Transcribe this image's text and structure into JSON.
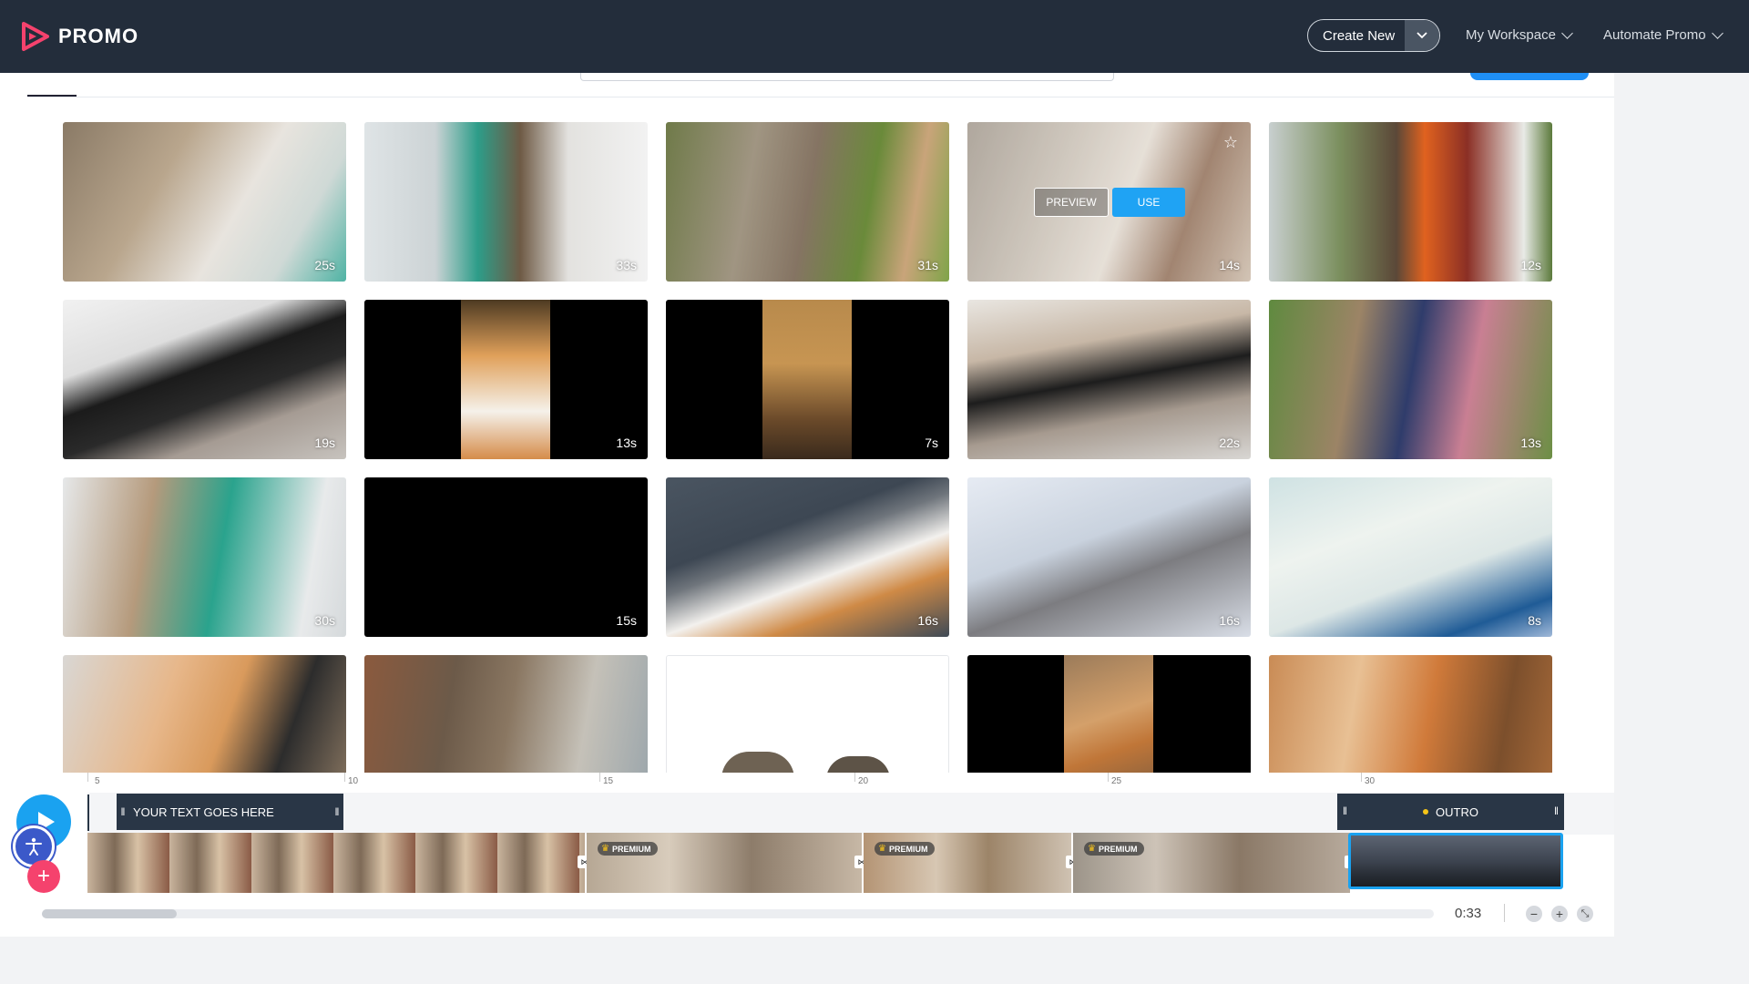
{
  "brand": {
    "name": "PROMO",
    "colors": {
      "topbar": "#232d3b",
      "accent": "#1aa2f0",
      "pink": "#f5426d"
    }
  },
  "header": {
    "create_new": "Create New",
    "my_workspace": "My Workspace",
    "automate_promo": "Automate Promo"
  },
  "grid": {
    "tiles": [
      {
        "duration": "25s"
      },
      {
        "duration": "33s"
      },
      {
        "duration": "31s"
      },
      {
        "duration": "14s",
        "hovered": true
      },
      {
        "duration": "12s"
      },
      {
        "duration": "19s"
      },
      {
        "duration": "13s"
      },
      {
        "duration": "7s"
      },
      {
        "duration": "22s"
      },
      {
        "duration": "13s"
      },
      {
        "duration": "30s"
      },
      {
        "duration": "15s"
      },
      {
        "duration": "16s"
      },
      {
        "duration": "16s"
      },
      {
        "duration": "8s"
      },
      {
        "duration": ""
      },
      {
        "duration": ""
      },
      {
        "duration": ""
      },
      {
        "duration": ""
      },
      {
        "duration": ""
      }
    ],
    "hover": {
      "preview_label": "PREVIEW",
      "use_label": "USE",
      "star_icon": "star-outline-icon"
    }
  },
  "timeline": {
    "ruler_ticks": [
      "5",
      "10",
      "15",
      "20",
      "25",
      "30"
    ],
    "text_clip_label": "YOUR TEXT GOES HERE",
    "outro_label": "OUTRO",
    "premium_label": "PREMIUM",
    "time": "0:33",
    "icons": {
      "play": "play-icon",
      "accessibility": "accessibility-icon",
      "add": "plus-icon",
      "zoom_out": "minus-icon",
      "zoom_in": "plus-icon",
      "fit": "collapse-icon"
    }
  }
}
